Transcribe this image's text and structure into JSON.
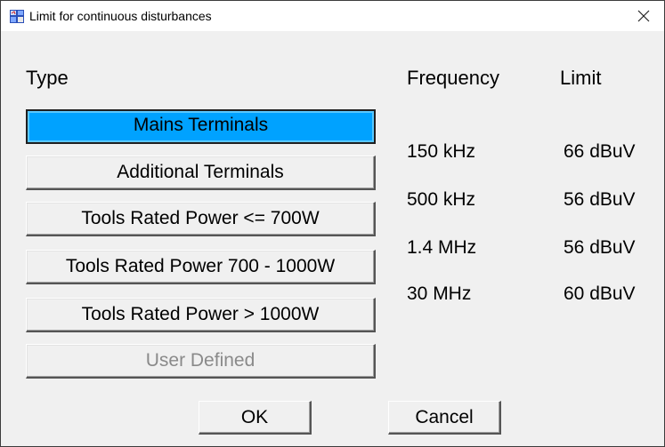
{
  "window": {
    "title": "Limit for continuous disturbances",
    "icon": "app-icon",
    "close_icon": "close-icon"
  },
  "headers": {
    "type": "Type",
    "frequency": "Frequency",
    "limit": "Limit"
  },
  "type_buttons": [
    {
      "label": "Mains Terminals",
      "state": "selected"
    },
    {
      "label": "Additional Terminals",
      "state": "normal"
    },
    {
      "label": "Tools Rated Power <= 700W",
      "state": "normal"
    },
    {
      "label": "Tools Rated Power 700 - 1000W",
      "state": "normal"
    },
    {
      "label": "Tools Rated Power > 1000W",
      "state": "normal"
    },
    {
      "label": "User Defined",
      "state": "disabled"
    }
  ],
  "limits_table": [
    {
      "frequency": "150 kHz",
      "limit": "66 dBuV"
    },
    {
      "frequency": "500 kHz",
      "limit": "56 dBuV"
    },
    {
      "frequency": "1.4 MHz",
      "limit": "56 dBuV"
    },
    {
      "frequency": "30 MHz",
      "limit": "60 dBuV"
    }
  ],
  "footer": {
    "ok_label": "OK",
    "cancel_label": "Cancel"
  },
  "colors": {
    "selected_button": "#00a2ff",
    "dialog_background": "#f0f0f0",
    "disabled_text": "#8a8a8a"
  }
}
